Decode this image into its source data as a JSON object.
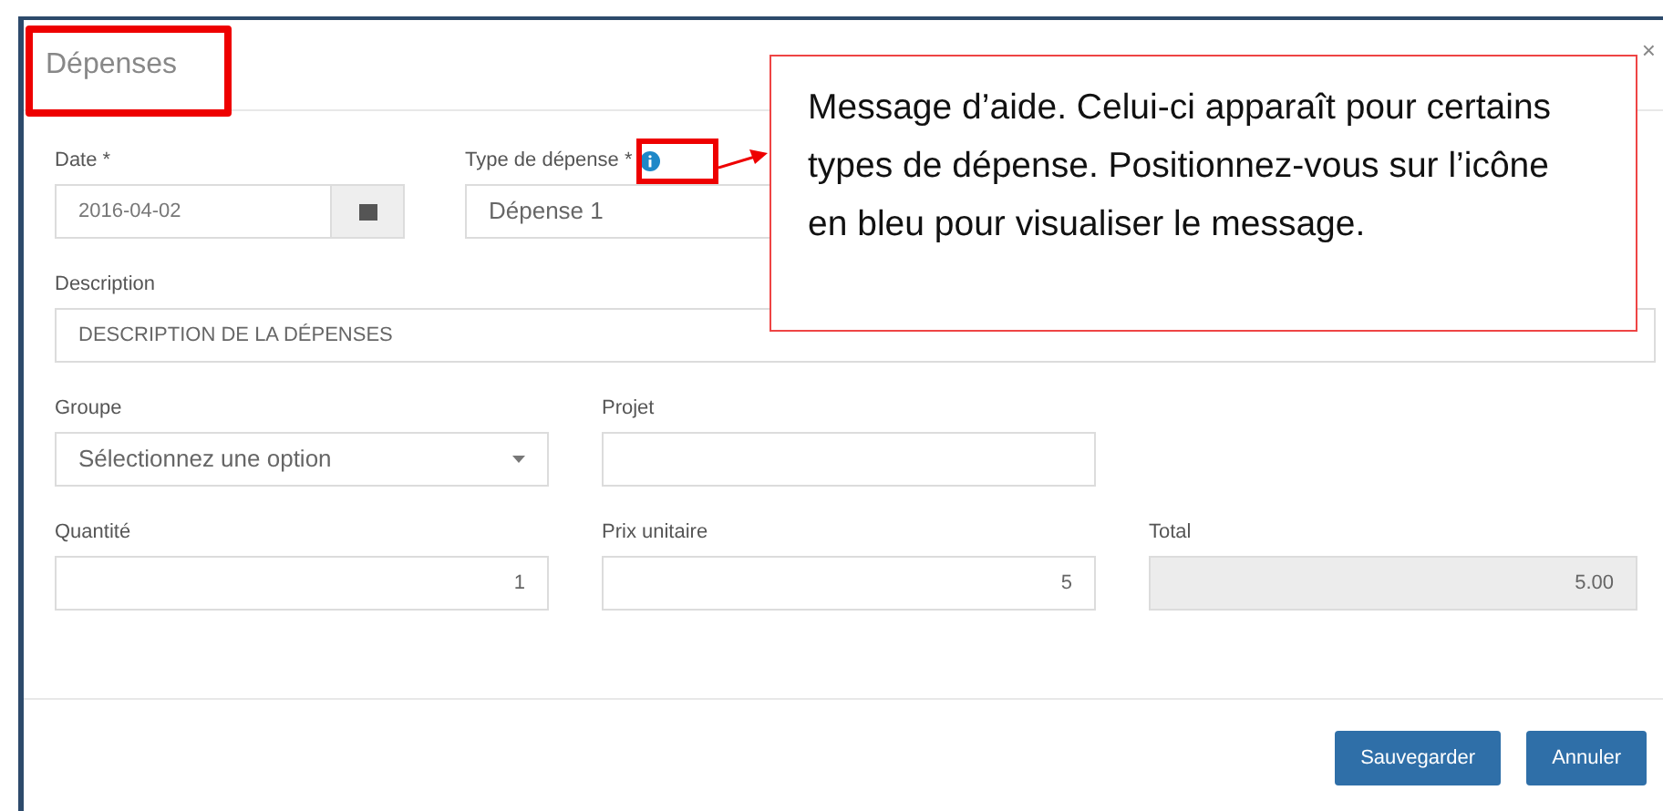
{
  "dialog": {
    "title": "Dépenses",
    "close": "×"
  },
  "rows": [
    [
      {
        "kind": "date",
        "label": "Date *",
        "value": "2016-04-02"
      },
      {
        "kind": "select-info",
        "label": "Type de dépense *",
        "value": "Dépense 1"
      }
    ],
    [
      {
        "kind": "text-wide",
        "label": "Description",
        "value": "DESCRIPTION DE LA DÉPENSES"
      }
    ],
    [
      {
        "kind": "select",
        "label": "Groupe",
        "value": "Sélectionnez une option"
      },
      {
        "kind": "text",
        "label": "Projet"
      }
    ],
    [
      {
        "kind": "number",
        "label": "Quantité",
        "value": "1"
      },
      {
        "kind": "number",
        "label": "Prix unitaire",
        "value": "5"
      },
      {
        "kind": "readonly",
        "label": "Total",
        "value": "5.00"
      }
    ]
  ],
  "buttons": [
    "Sauvegarder",
    "Annuler"
  ],
  "annotation": {
    "text": "Message d’aide. Celui-ci apparaît pour certains types de dépense. Positionnez-vous sur l’icône en bleu pour visualiser le message."
  }
}
